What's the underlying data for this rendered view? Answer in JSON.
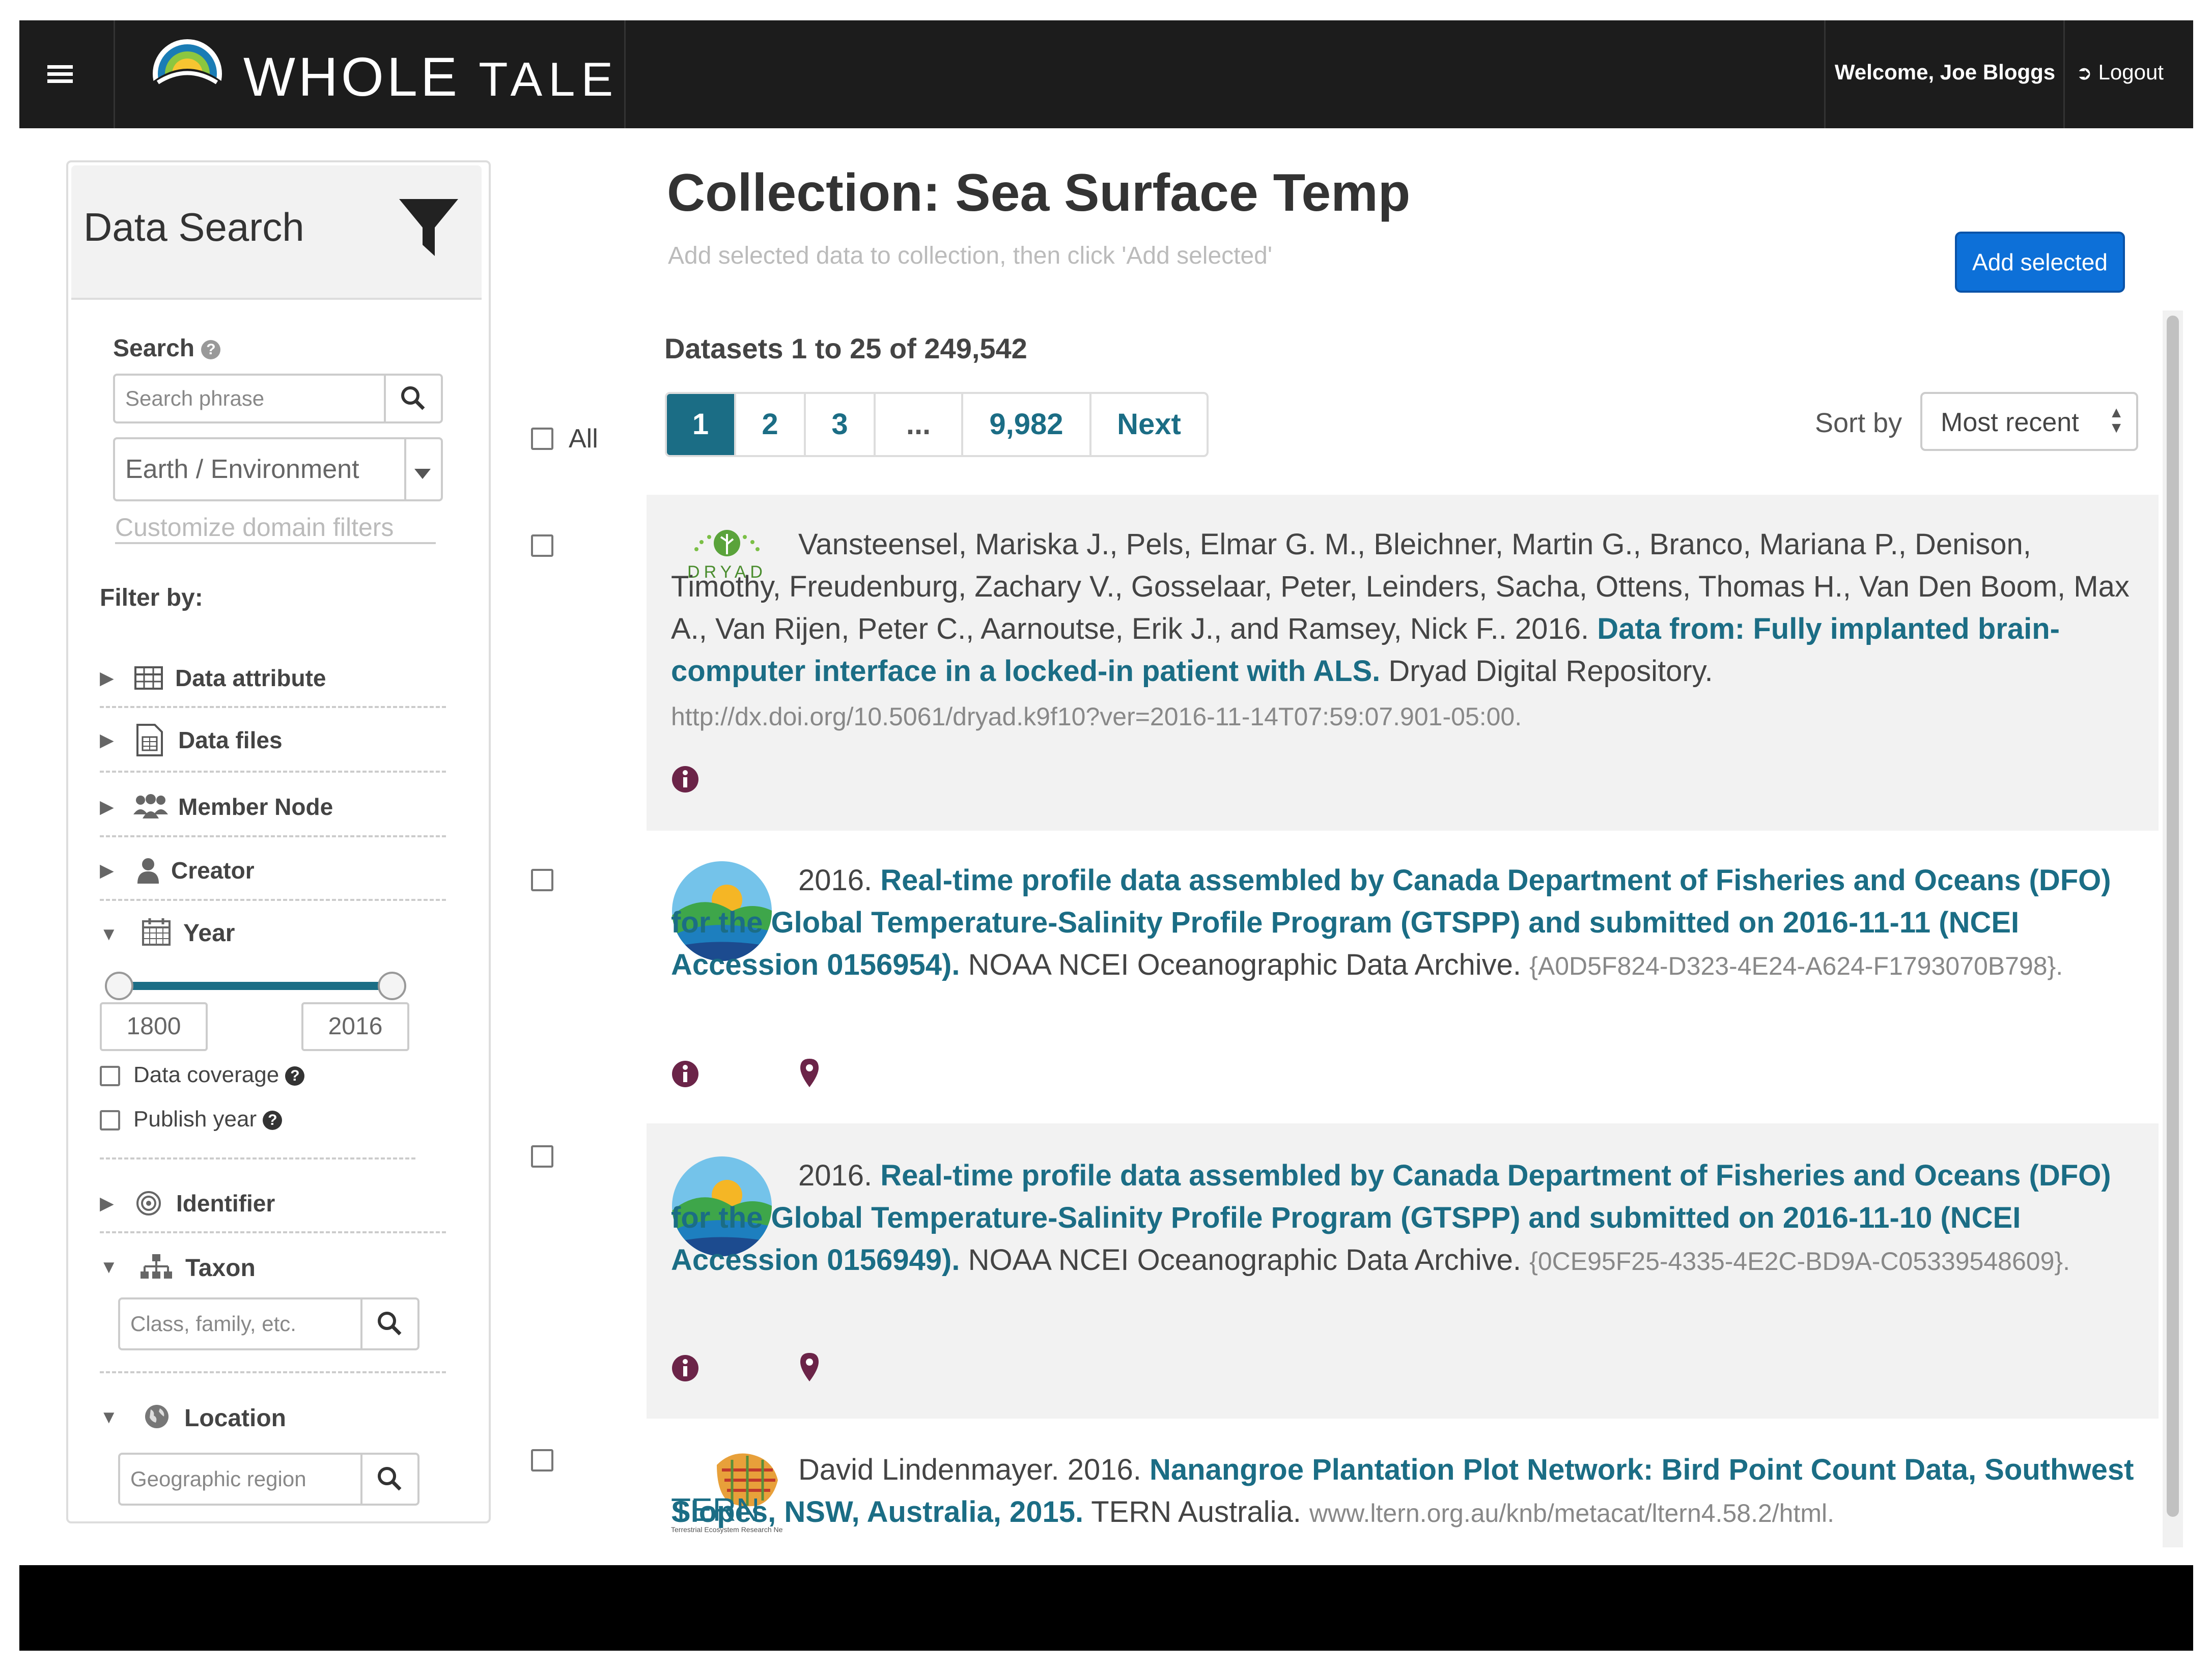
{
  "navbar": {
    "menu_icon": "list-icon",
    "logo_bold": "WHOLE",
    "logo_thin": "TALE",
    "welcome": "Welcome, Joe Bloggs",
    "logout": "Logout",
    "logout_icon": "sign-out-icon"
  },
  "sidebar": {
    "title": "Data Search",
    "filter_icon": "funnel-icon",
    "search_label": "Search",
    "search_placeholder": "Search phrase",
    "domain_select": "Earth / Environment",
    "customize": "Customize domain filters",
    "filter_by": "Filter by:",
    "filters": [
      {
        "label": "Data attribute",
        "icon": "table-icon"
      },
      {
        "label": "Data files",
        "icon": "file-icon"
      },
      {
        "label": "Member Node",
        "icon": "users-icon"
      },
      {
        "label": "Creator",
        "icon": "user-icon"
      },
      {
        "label": "Year",
        "icon": "calendar-icon"
      }
    ],
    "year": {
      "min": "1800",
      "max": "2016",
      "range_start": 0,
      "range_end": 1
    },
    "year_checks": [
      {
        "label": "Data coverage",
        "checked": false
      },
      {
        "label": "Publish year",
        "checked": false
      }
    ],
    "identifier": "Identifier",
    "taxon": "Taxon",
    "taxon_placeholder": "Class, family, etc.",
    "location": "Location",
    "location_placeholder": "Geographic region"
  },
  "main": {
    "title": "Collection: Sea Surface Temp",
    "subtitle": "Add selected data to collection, then click 'Add selected'",
    "add_button": "Add selected",
    "count": "Datasets 1 to 25 of 249,542",
    "all_label": "All",
    "pages": [
      "1",
      "2",
      "3",
      "...",
      "9,982",
      "Next"
    ],
    "active_page": "1",
    "sort_label": "Sort by",
    "sort_value": "Most recent"
  },
  "results": [
    {
      "logo": "DRYAD",
      "prefix": "Vansteensel, Mariska J., Pels, Elmar G. M., Bleichner, Martin G., Branco, Mariana P., Denison, Timothy, Freudenburg, Zachary V., Gosselaar, Peter, Leinders, Sacha, Ottens, Thomas H., Van Den Boom, Max A., Van Rijen, Peter C., Aarnoutse, Erik J., and Ramsey, Nick F.. 2016.",
      "title": "Data from: Fully implanted brain-computer interface in a locked-in patient with ALS.",
      "repo": "Dryad Digital Repository.",
      "doi": "http://dx.doi.org/10.5061/dryad.k9f10?ver=2016-11-14T07:59:07.901-05:00.",
      "icons": [
        "info-icon"
      ]
    },
    {
      "logo": "NOAA",
      "prefix": "2016.",
      "title": "Real-time profile data assembled by Canada Department of Fisheries and Oceans (DFO) for the Global Temperature-Salinity Profile Program (GTSPP) and submitted on 2016-11-11 (NCEI Accession 0156954).",
      "repo": "NOAA NCEI Oceanographic Data Archive.",
      "doi": "{A0D5F824-D323-4E24-A624-F1793070B798}.",
      "icons": [
        "info-icon",
        "map-marker-icon"
      ]
    },
    {
      "logo": "NOAA",
      "prefix": "2016.",
      "title": "Real-time profile data assembled by Canada Department of Fisheries and Oceans (DFO) for the Global Temperature-Salinity Profile Program (GTSPP) and submitted on 2016-11-10 (NCEI Accession 0156949).",
      "repo": "NOAA NCEI Oceanographic Data Archive.",
      "doi": "{0CE95F25-4335-4E2C-BD9A-C05339548609}.",
      "icons": [
        "info-icon",
        "map-marker-icon"
      ]
    },
    {
      "logo": "TERN",
      "logo_sub": "Terrestrial Ecosystem Research Network",
      "prefix": "David Lindenmayer. 2016.",
      "title": "Nanangroe Plantation Plot Network: Bird Point Count Data, Southwest Slopes, NSW, Australia, 2015.",
      "repo": "TERN Australia.",
      "doi": "www.ltern.org.au/knb/metacat/ltern4.58.2/html.",
      "icons": []
    }
  ],
  "colors": {
    "navbar": "#1c1c1c",
    "link": "#1b6d85",
    "primary_button": "#0d70d8",
    "info_icon": "#6b2448"
  }
}
